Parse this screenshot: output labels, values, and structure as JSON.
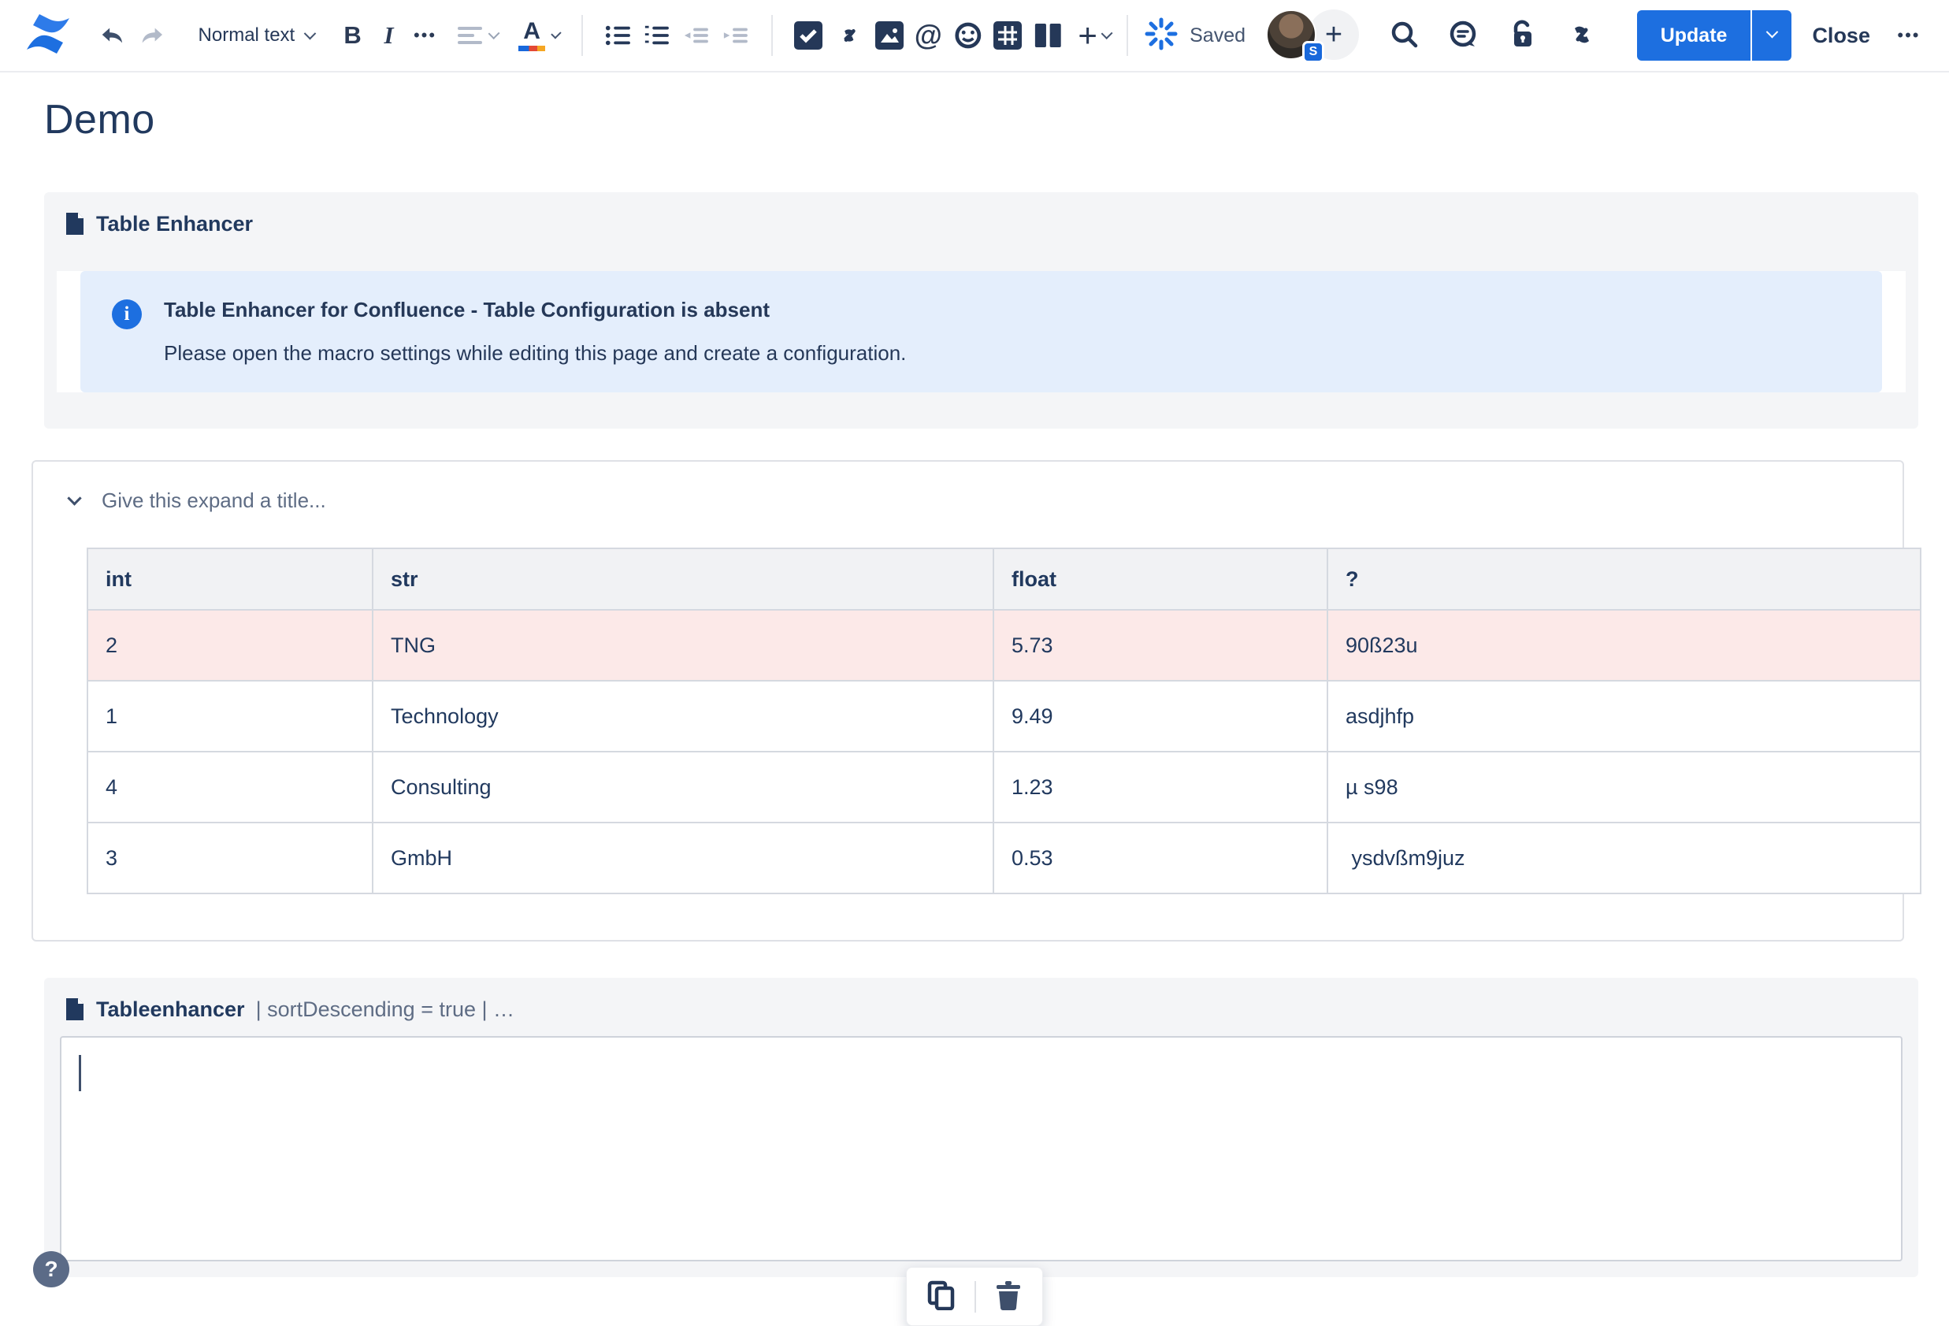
{
  "toolbar": {
    "text_style_label": "Normal text",
    "bold_glyph": "B",
    "italic_glyph": "I",
    "more_formatting_glyph": "•••",
    "mention_glyph": "@",
    "insert_plus_glyph": "+",
    "saved_label": "Saved",
    "avatar_badge": "S",
    "add_collaborator_glyph": "+",
    "update_label": "Update",
    "close_label": "Close",
    "overflow_glyph": "•••"
  },
  "page": {
    "title": "Demo"
  },
  "macro1": {
    "name": "Table Enhancer",
    "panel": {
      "title": "Table Enhancer for Confluence - Table Configuration is absent",
      "body": "Please open the macro settings while editing this page and create a configuration."
    }
  },
  "expand": {
    "title_placeholder": "Give this expand a title...",
    "table": {
      "headers": [
        "int",
        "str",
        "float",
        "?"
      ],
      "rows": [
        {
          "cells": [
            "2",
            "TNG",
            "5.73",
            "90ß23u"
          ],
          "highlight": true
        },
        {
          "cells": [
            "1",
            "Technology",
            "9.49",
            "asdjhfp"
          ],
          "highlight": false
        },
        {
          "cells": [
            "4",
            "Consulting",
            "1.23",
            "µ s98"
          ],
          "highlight": false
        },
        {
          "cells": [
            "3",
            "GmbH",
            "0.53",
            " ysdvßm9juz"
          ],
          "highlight": false
        }
      ]
    }
  },
  "macro2": {
    "name": "Tableenhancer",
    "params": "| sortDescending = true | …"
  },
  "help": {
    "glyph": "?"
  },
  "colors": {
    "accent_blue": "#1D6FE0",
    "info_panel_bg": "#E4EEFC",
    "row_highlight": "#FCE9E8",
    "table_header_bg": "#F1F2F4",
    "macro_bg": "#F4F5F7",
    "dark_text": "#21395E"
  }
}
